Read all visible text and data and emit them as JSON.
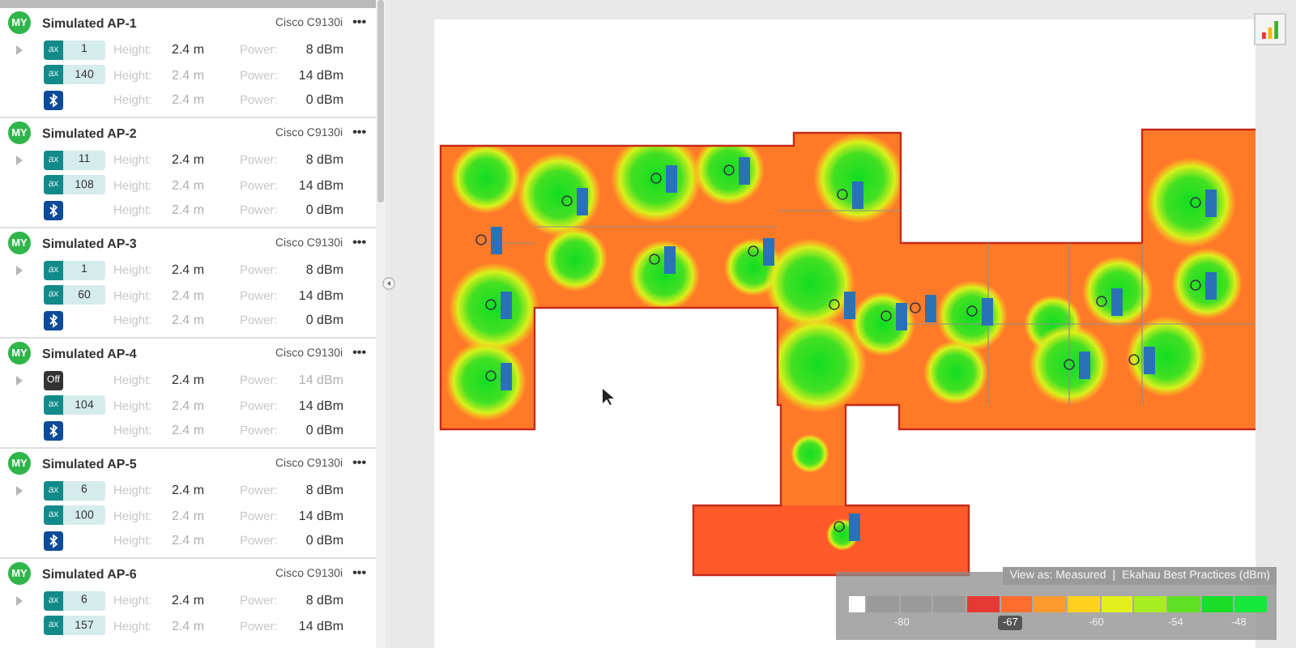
{
  "panel": {
    "access_points": [
      {
        "avatar": "MY",
        "name": "Simulated AP-1",
        "model": "Cisco C9130i",
        "menu": "•••",
        "radios": [
          {
            "kind": "ax",
            "badge": "ax",
            "channel": "1",
            "height_label": "Height:",
            "height": "2.4 m",
            "height_dimmed": false,
            "power_label": "Power:",
            "power": "8 dBm",
            "power_dimmed": false
          },
          {
            "kind": "ax",
            "badge": "ax",
            "channel": "140",
            "height_label": "Height:",
            "height": "2.4 m",
            "height_dimmed": true,
            "power_label": "Power:",
            "power": "14 dBm",
            "power_dimmed": false
          },
          {
            "kind": "bluetooth",
            "height_label": "Height:",
            "height": "2.4 m",
            "height_dimmed": true,
            "power_label": "Power:",
            "power": "0 dBm",
            "power_dimmed": false
          }
        ]
      },
      {
        "avatar": "MY",
        "name": "Simulated AP-2",
        "model": "Cisco C9130i",
        "menu": "•••",
        "radios": [
          {
            "kind": "ax",
            "badge": "ax",
            "channel": "11",
            "height_label": "Height:",
            "height": "2.4 m",
            "height_dimmed": false,
            "power_label": "Power:",
            "power": "8 dBm",
            "power_dimmed": false
          },
          {
            "kind": "ax",
            "badge": "ax",
            "channel": "108",
            "height_label": "Height:",
            "height": "2.4 m",
            "height_dimmed": true,
            "power_label": "Power:",
            "power": "14 dBm",
            "power_dimmed": false
          },
          {
            "kind": "bluetooth",
            "height_label": "Height:",
            "height": "2.4 m",
            "height_dimmed": true,
            "power_label": "Power:",
            "power": "0 dBm",
            "power_dimmed": false
          }
        ]
      },
      {
        "avatar": "MY",
        "name": "Simulated AP-3",
        "model": "Cisco C9130i",
        "menu": "•••",
        "radios": [
          {
            "kind": "ax",
            "badge": "ax",
            "channel": "1",
            "height_label": "Height:",
            "height": "2.4 m",
            "height_dimmed": false,
            "power_label": "Power:",
            "power": "8 dBm",
            "power_dimmed": false
          },
          {
            "kind": "ax",
            "badge": "ax",
            "channel": "60",
            "height_label": "Height:",
            "height": "2.4 m",
            "height_dimmed": true,
            "power_label": "Power:",
            "power": "14 dBm",
            "power_dimmed": false
          },
          {
            "kind": "bluetooth",
            "height_label": "Height:",
            "height": "2.4 m",
            "height_dimmed": true,
            "power_label": "Power:",
            "power": "0 dBm",
            "power_dimmed": false
          }
        ]
      },
      {
        "avatar": "MY",
        "name": "Simulated AP-4",
        "model": "Cisco C9130i",
        "menu": "•••",
        "radios": [
          {
            "kind": "off",
            "badge": "Off",
            "height_label": "Height:",
            "height": "2.4 m",
            "height_dimmed": false,
            "power_label": "Power:",
            "power": "14 dBm",
            "power_dimmed": true
          },
          {
            "kind": "ax",
            "badge": "ax",
            "channel": "104",
            "height_label": "Height:",
            "height": "2.4 m",
            "height_dimmed": true,
            "power_label": "Power:",
            "power": "14 dBm",
            "power_dimmed": false
          },
          {
            "kind": "bluetooth",
            "height_label": "Height:",
            "height": "2.4 m",
            "height_dimmed": true,
            "power_label": "Power:",
            "power": "0 dBm",
            "power_dimmed": false
          }
        ]
      },
      {
        "avatar": "MY",
        "name": "Simulated AP-5",
        "model": "Cisco C9130i",
        "menu": "•••",
        "radios": [
          {
            "kind": "ax",
            "badge": "ax",
            "channel": "6",
            "height_label": "Height:",
            "height": "2.4 m",
            "height_dimmed": false,
            "power_label": "Power:",
            "power": "8 dBm",
            "power_dimmed": false
          },
          {
            "kind": "ax",
            "badge": "ax",
            "channel": "100",
            "height_label": "Height:",
            "height": "2.4 m",
            "height_dimmed": true,
            "power_label": "Power:",
            "power": "14 dBm",
            "power_dimmed": false
          },
          {
            "kind": "bluetooth",
            "height_label": "Height:",
            "height": "2.4 m",
            "height_dimmed": true,
            "power_label": "Power:",
            "power": "0 dBm",
            "power_dimmed": false
          }
        ]
      },
      {
        "avatar": "MY",
        "name": "Simulated AP-6",
        "model": "Cisco C9130i",
        "menu": "•••",
        "radios": [
          {
            "kind": "ax",
            "badge": "ax",
            "channel": "6",
            "height_label": "Height:",
            "height": "2.4 m",
            "height_dimmed": false,
            "power_label": "Power:",
            "power": "8 dBm",
            "power_dimmed": false
          },
          {
            "kind": "ax",
            "badge": "ax",
            "channel": "157",
            "height_label": "Height:",
            "height": "2.4 m",
            "height_dimmed": true,
            "power_label": "Power:",
            "power": "14 dBm",
            "power_dimmed": false
          }
        ]
      }
    ]
  },
  "legend": {
    "view_as": "View as: Measured",
    "separator": "|",
    "scheme": "Ekahau Best Practices (dBm)",
    "threshold": "-67",
    "ticks": [
      "-80",
      "-60",
      "-54",
      "-48"
    ]
  }
}
